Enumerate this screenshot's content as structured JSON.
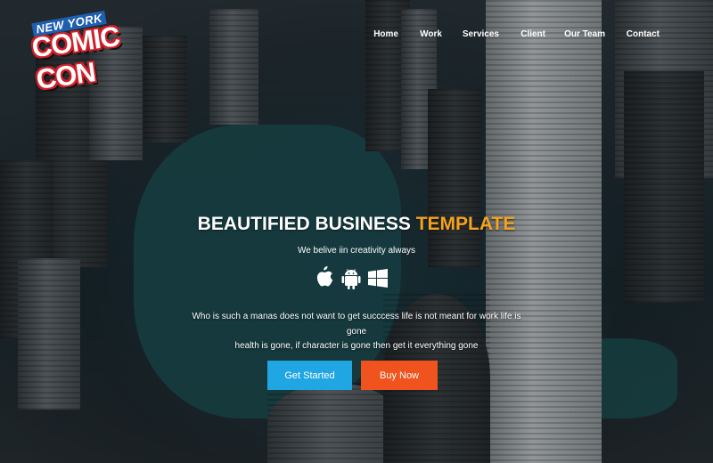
{
  "brand": {
    "logo_top": "NEW YORK",
    "logo_main": "COMIC CON"
  },
  "nav": {
    "items": [
      "Home",
      "Work",
      "Services",
      "Client",
      "Our Team",
      "Contact"
    ]
  },
  "hero": {
    "title_main": "BEAUTIFIED BUSINESS",
    "title_accent": "TEMPLATE",
    "tagline": "We belive iin creativity always",
    "platform_icons": [
      "apple-icon",
      "android-icon",
      "windows-icon"
    ],
    "description_line1": "Who is such a manas does not want to get succcess life is not meant for work life is gone",
    "description_line2": "health is gone, if character is gone then get it everything gone",
    "buttons": {
      "get_started": "Get Started",
      "buy_now": "Buy Now"
    }
  },
  "colors": {
    "accent_orange": "#f5a31d",
    "primary_blue": "#1fa6e3",
    "buy_orange": "#f0531e"
  }
}
